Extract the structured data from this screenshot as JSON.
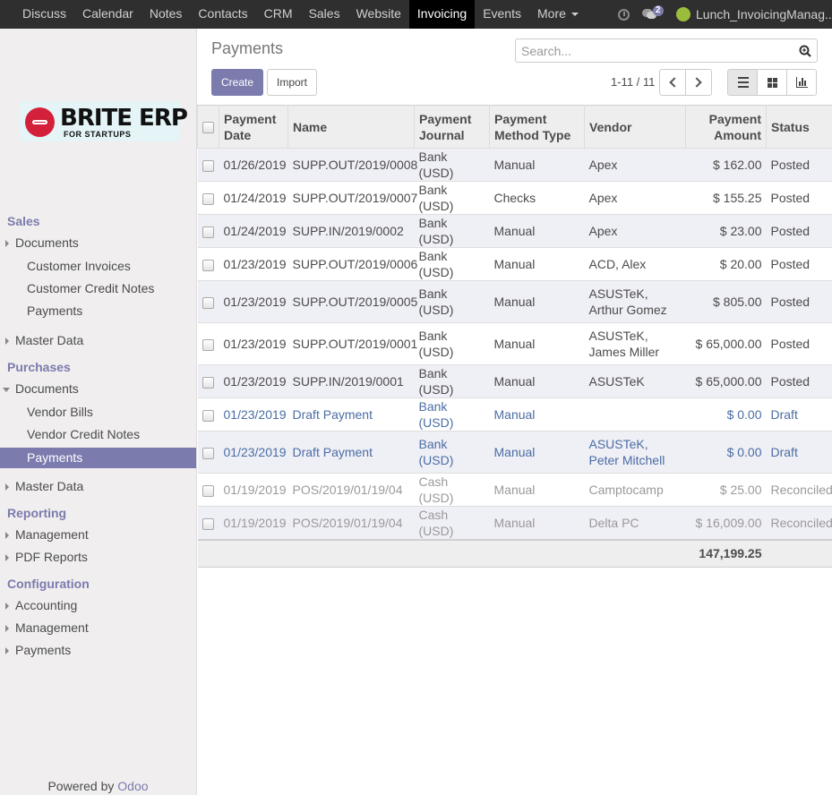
{
  "topbar": {
    "menu": [
      "Discuss",
      "Calendar",
      "Notes",
      "Contacts",
      "CRM",
      "Sales",
      "Website",
      "Invoicing",
      "Events"
    ],
    "active": "Invoicing",
    "more_label": "More",
    "messages_count": "2",
    "user": "Lunch_InvoicingManag..."
  },
  "logo": {
    "line1": "BRITE ERP",
    "line2": "FOR STARTUPS"
  },
  "sidebar": {
    "sales": "Sales",
    "sales_documents": "Documents",
    "customer_invoices": "Customer Invoices",
    "customer_credit_notes": "Customer Credit Notes",
    "sales_payments": "Payments",
    "sales_master_data": "Master Data",
    "purchases": "Purchases",
    "purchases_documents": "Documents",
    "vendor_bills": "Vendor Bills",
    "vendor_credit_notes": "Vendor Credit Notes",
    "purchases_payments": "Payments",
    "purchases_master_data": "Master Data",
    "reporting": "Reporting",
    "reporting_management": "Management",
    "pdf_reports": "PDF Reports",
    "configuration": "Configuration",
    "config_accounting": "Accounting",
    "config_management": "Management",
    "config_payments": "Payments",
    "powered_by": "Powered by",
    "odoo": "Odoo"
  },
  "page": {
    "title": "Payments",
    "search_placeholder": "Search...",
    "create_label": "Create",
    "import_label": "Import",
    "pager": "1-11 / 11"
  },
  "table": {
    "headers": {
      "date": "Payment Date",
      "name": "Name",
      "journal": "Payment Journal",
      "method": "Payment Method Type",
      "vendor": "Vendor",
      "amount": "Payment Amount",
      "status": "Status"
    },
    "rows": [
      {
        "date": "01/26/2019",
        "name": "SUPP.OUT/2019/0008",
        "journal": "Bank (USD)",
        "method": "Manual",
        "vendor": "Apex",
        "amount": "$ 162.00",
        "status": "Posted"
      },
      {
        "date": "01/24/2019",
        "name": "SUPP.OUT/2019/0007",
        "journal": "Bank (USD)",
        "method": "Checks",
        "vendor": "Apex",
        "amount": "$ 155.25",
        "status": "Posted"
      },
      {
        "date": "01/24/2019",
        "name": "SUPP.IN/2019/0002",
        "journal": "Bank (USD)",
        "method": "Manual",
        "vendor": "Apex",
        "amount": "$ 23.00",
        "status": "Posted"
      },
      {
        "date": "01/23/2019",
        "name": "SUPP.OUT/2019/0006",
        "journal": "Bank (USD)",
        "method": "Manual",
        "vendor": "ACD, Alex",
        "amount": "$ 20.00",
        "status": "Posted"
      },
      {
        "date": "01/23/2019",
        "name": "SUPP.OUT/2019/0005",
        "journal": "Bank (USD)",
        "method": "Manual",
        "vendor": "ASUSTeK, Arthur Gomez",
        "amount": "$ 805.00",
        "status": "Posted"
      },
      {
        "date": "01/23/2019",
        "name": "SUPP.OUT/2019/0001",
        "journal": "Bank (USD)",
        "method": "Manual",
        "vendor": "ASUSTeK, James Miller",
        "amount": "$ 65,000.00",
        "status": "Posted"
      },
      {
        "date": "01/23/2019",
        "name": "SUPP.IN/2019/0001",
        "journal": "Bank (USD)",
        "method": "Manual",
        "vendor": "ASUSTeK",
        "amount": "$ 65,000.00",
        "status": "Posted"
      },
      {
        "date": "01/23/2019",
        "name": "Draft Payment",
        "journal": "Bank (USD)",
        "method": "Manual",
        "vendor": "",
        "amount": "$ 0.00",
        "status": "Draft"
      },
      {
        "date": "01/23/2019",
        "name": "Draft Payment",
        "journal": "Bank (USD)",
        "method": "Manual",
        "vendor": "ASUSTeK, Peter Mitchell",
        "amount": "$ 0.00",
        "status": "Draft"
      },
      {
        "date": "01/19/2019",
        "name": "POS/2019/01/19/04",
        "journal": "Cash (USD)",
        "method": "Manual",
        "vendor": "Camptocamp",
        "amount": "$ 25.00",
        "status": "Reconciled"
      },
      {
        "date": "01/19/2019",
        "name": "POS/2019/01/19/04",
        "journal": "Cash (USD)",
        "method": "Manual",
        "vendor": "Delta PC",
        "amount": "$ 16,009.00",
        "status": "Reconciled"
      }
    ],
    "total": "147,199.25"
  },
  "colors": {
    "brand": "#7c7bad",
    "topbar": "#2f2f2f",
    "draft": "#4b6da3"
  }
}
